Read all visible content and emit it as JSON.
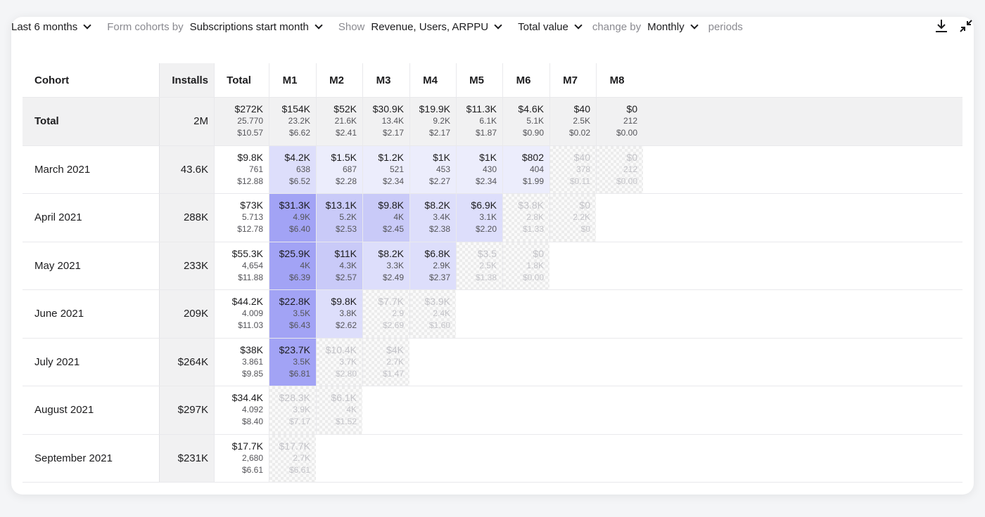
{
  "toolbar": {
    "period": "Last 6 months",
    "form_label": "Form cohorts by",
    "form_value": "Subscriptions start month",
    "show_label": "Show",
    "show_value": "Revenue, Users, ARPPU",
    "value_mode": "Total value",
    "change_label": "change by",
    "change_value": "Monthly",
    "periods_label": "periods",
    "icons": [
      "download-icon",
      "collapse-icon"
    ]
  },
  "colors": {
    "accent_strong": "#a2a3f5",
    "accent_medium": "#c9caf8",
    "accent_light": "#dddefb",
    "accent_faint": "#ecedfc",
    "panel_gray": "#f1f1f2"
  },
  "table": {
    "headers": [
      "Cohort",
      "Installs",
      "Total",
      "M1",
      "M2",
      "M3",
      "M4",
      "M5",
      "M6",
      "M7",
      "M8"
    ],
    "rows": [
      {
        "label": "Total",
        "installs": "2M",
        "total": [
          "$272K",
          "25.770",
          "$10.57"
        ],
        "months": [
          [
            "$154K",
            "23.2K",
            "$6.62"
          ],
          [
            "$52K",
            "21.6K",
            "$2.41"
          ],
          [
            "$30.9K",
            "13.4K",
            "$2.17"
          ],
          [
            "$19.9K",
            "9.2K",
            "$2.17"
          ],
          [
            "$11.3K",
            "6.1K",
            "$1.87"
          ],
          [
            "$4.6K",
            "5.1K",
            "$0.90"
          ],
          [
            "$40",
            "2.5K",
            "$0.02"
          ],
          [
            "$0",
            "212",
            "$0.00"
          ]
        ]
      },
      {
        "label": "March 2021",
        "installs": "43.6K",
        "total": [
          "$9.8K",
          "761",
          "$12.88"
        ],
        "months": [
          [
            "$4.2K",
            "638",
            "$6.52"
          ],
          [
            "$1.5K",
            "687",
            "$2.28"
          ],
          [
            "$1.2K",
            "521",
            "$2.34"
          ],
          [
            "$1K",
            "453",
            "$2.27"
          ],
          [
            "$1K",
            "430",
            "$2.34"
          ],
          [
            "$802",
            "404",
            "$1.99"
          ],
          [
            "$40",
            "378",
            "$0.11"
          ],
          [
            "$0",
            "212",
            "$0.00"
          ]
        ]
      },
      {
        "label": "April 2021",
        "installs": "288K",
        "total": [
          "$73K",
          "5.713",
          "$12.78"
        ],
        "months": [
          [
            "$31.3K",
            "4.9K",
            "$6.40"
          ],
          [
            "$13.1K",
            "5.2K",
            "$2.53"
          ],
          [
            "$9.8K",
            "4K",
            "$2.45"
          ],
          [
            "$8.2K",
            "3.4K",
            "$2.38"
          ],
          [
            "$6.9K",
            "3.1K",
            "$2.20"
          ],
          [
            "$3.8K",
            "2.8K",
            "$1.33"
          ],
          [
            "$0",
            "2.2K",
            "$0"
          ]
        ]
      },
      {
        "label": "May 2021",
        "installs": "233K",
        "total": [
          "$55.3K",
          "4,654",
          "$11.88"
        ],
        "months": [
          [
            "$25.9K",
            "4K",
            "$6.39"
          ],
          [
            "$11K",
            "4.3K",
            "$2.57"
          ],
          [
            "$8.2K",
            "3.3K",
            "$2.49"
          ],
          [
            "$6.8K",
            "2.9K",
            "$2.37"
          ],
          [
            "$3.5",
            "2.5K",
            "$1.38"
          ],
          [
            "$0",
            "1.8K",
            "$0.00"
          ]
        ]
      },
      {
        "label": "June 2021",
        "installs": "209K",
        "total": [
          "$44.2K",
          "4.009",
          "$11.03"
        ],
        "months": [
          [
            "$22.8K",
            "3.5K",
            "$6.43"
          ],
          [
            "$9.8K",
            "3.8K",
            "$2.62"
          ],
          [
            "$7.7K",
            "2.9",
            "$2.69"
          ],
          [
            "$3.9K",
            "2.4K",
            "$1.60"
          ]
        ]
      },
      {
        "label": "July 2021",
        "installs": "$264K",
        "total": [
          "$38K",
          "3.861",
          "$9.85"
        ],
        "months": [
          [
            "$23.7K",
            "3.5K",
            "$6.81"
          ],
          [
            "$10.4K",
            "3.7K",
            "$2.80"
          ],
          [
            "$4K",
            "2.7K",
            "$1.47"
          ]
        ]
      },
      {
        "label": "August 2021",
        "installs": "$297K",
        "total": [
          "$34.4K",
          "4.092",
          "$8.40"
        ],
        "months": [
          [
            "$28.3K",
            "3.9K",
            "$7.17"
          ],
          [
            "$6.1K",
            "4K",
            "$1.52"
          ]
        ]
      },
      {
        "label": "September 2021",
        "installs": "$231K",
        "total": [
          "$17.7K",
          "2,680",
          "$6.61"
        ],
        "months": [
          [
            "$17.7K",
            "2.7K",
            "$6.61"
          ]
        ]
      }
    ],
    "cell_style": [
      [
        "plain",
        "plain",
        "plain",
        "plain",
        "plain",
        "plain",
        "plain",
        "plain"
      ],
      [
        "light",
        "faint",
        "faint",
        "faint",
        "faint",
        "faint",
        "ghost",
        "ghost"
      ],
      [
        "strong",
        "medium",
        "medium",
        "light",
        "light",
        "ghost",
        "ghost"
      ],
      [
        "strong",
        "medium",
        "light",
        "light",
        "ghost",
        "ghost"
      ],
      [
        "strong",
        "light",
        "ghost",
        "ghost"
      ],
      [
        "strong",
        "ghost",
        "ghost"
      ],
      [
        "ghost",
        "ghost"
      ],
      [
        "ghost"
      ]
    ]
  }
}
